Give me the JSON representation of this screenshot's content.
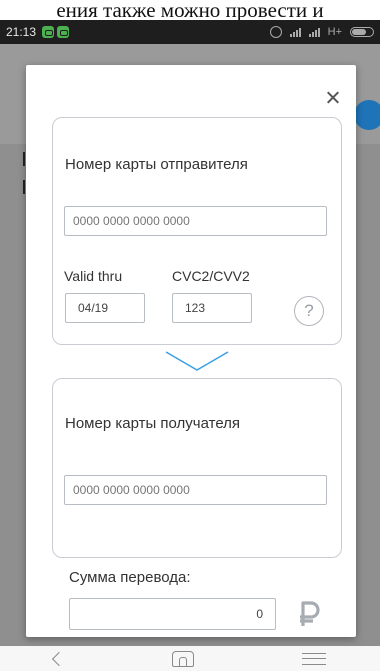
{
  "top_caption": "ения также можно провести и",
  "status_bar": {
    "time": "21:13",
    "network": "H+"
  },
  "dialog": {
    "sender_card": {
      "title": "Номер карты отправителя",
      "card_number_placeholder": "0000 0000 0000 0000",
      "valid_thru_label": "Valid thru",
      "valid_thru_value": "04/19",
      "cvc_label": "CVC2/CVV2",
      "cvc_value": "123",
      "help_label": "?"
    },
    "recipient_card": {
      "title": "Номер карты получателя",
      "card_number_placeholder": "0000 0000 0000 0000"
    },
    "amount": {
      "label": "Сумма перевода:",
      "value": "0",
      "currency_icon": "ruble-icon"
    }
  },
  "colors": {
    "accent": "#1f73b7",
    "chevron": "#3aa0e6",
    "currency_icon": "#a7abb2"
  }
}
